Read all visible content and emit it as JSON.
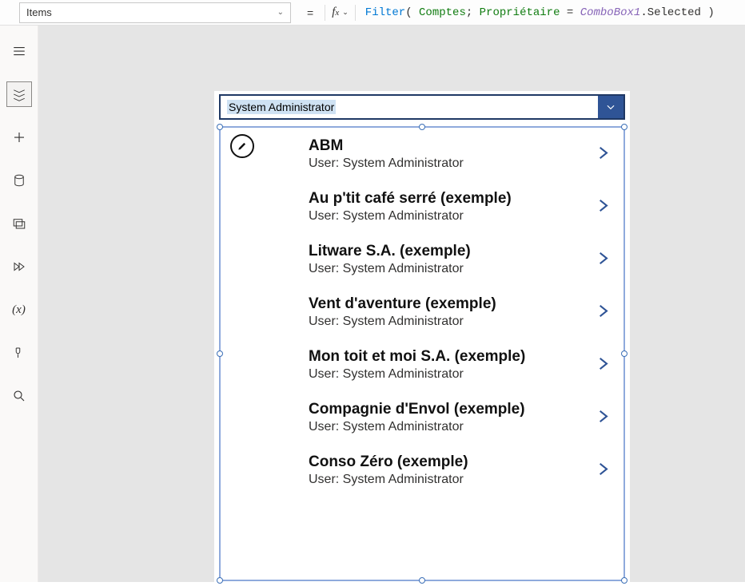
{
  "property_selector": {
    "value": "Items"
  },
  "formula": {
    "fn": "Filter",
    "arg1": "Comptes",
    "arg2_left": "Propriétaire",
    "arg2_right_obj": "ComboBox1",
    "arg2_right_prop": ".Selected"
  },
  "combo": {
    "selected_text": "System Administrator"
  },
  "sub_prefix": "User: ",
  "items": [
    {
      "title": "ABM",
      "user": "System Administrator"
    },
    {
      "title": "Au p'tit café serré (exemple)",
      "user": "System Administrator"
    },
    {
      "title": "Litware S.A. (exemple)",
      "user": "System Administrator"
    },
    {
      "title": "Vent d'aventure (exemple)",
      "user": "System Administrator"
    },
    {
      "title": "Mon toit et moi S.A. (exemple)",
      "user": "System Administrator"
    },
    {
      "title": "Compagnie d'Envol (exemple)",
      "user": "System Administrator"
    },
    {
      "title": "Conso Zéro (exemple)",
      "user": "System Administrator"
    }
  ]
}
